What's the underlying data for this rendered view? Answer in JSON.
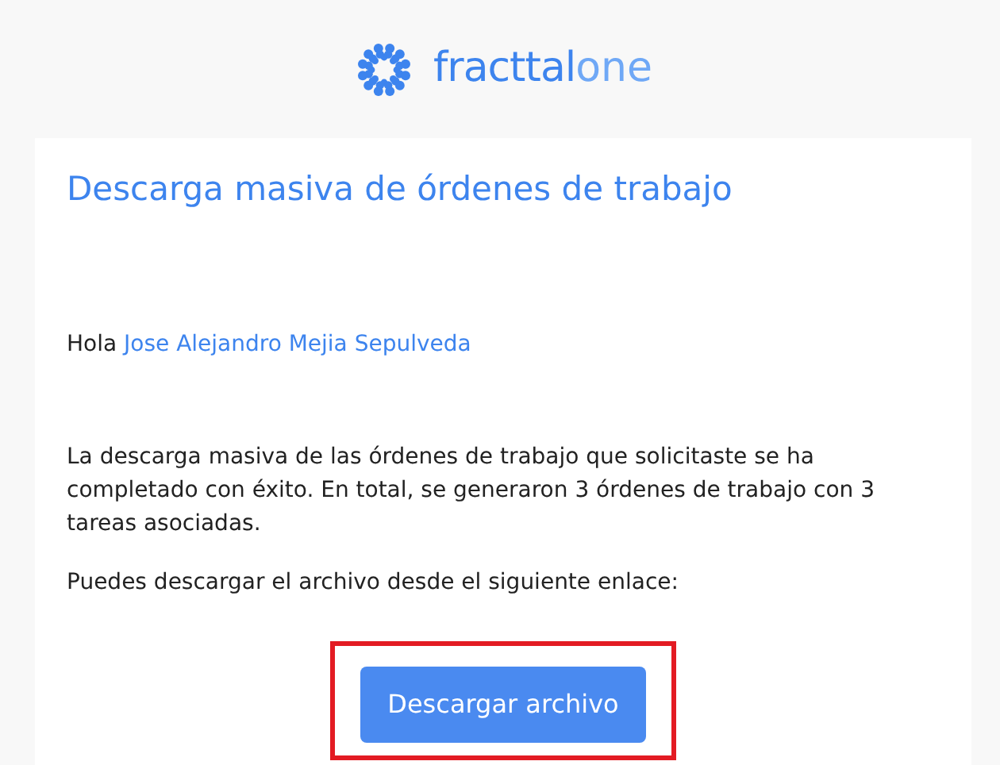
{
  "logo": {
    "name": "fracttal",
    "suffix": "one"
  },
  "title": "Descarga masiva de órdenes de trabajo",
  "greeting": {
    "text": "Hola",
    "recipient": "Jose Alejandro Mejia Sepulveda"
  },
  "paragraphs": [
    "La descarga masiva de las órdenes de trabajo que solicitaste se ha completado con éxito. En total, se generaron 3 órdenes de trabajo con 3 tareas asociadas.",
    "Puedes descargar el archivo desde el siguiente enlace:"
  ],
  "button": {
    "label": "Descargar archivo",
    "highlighted": true
  }
}
